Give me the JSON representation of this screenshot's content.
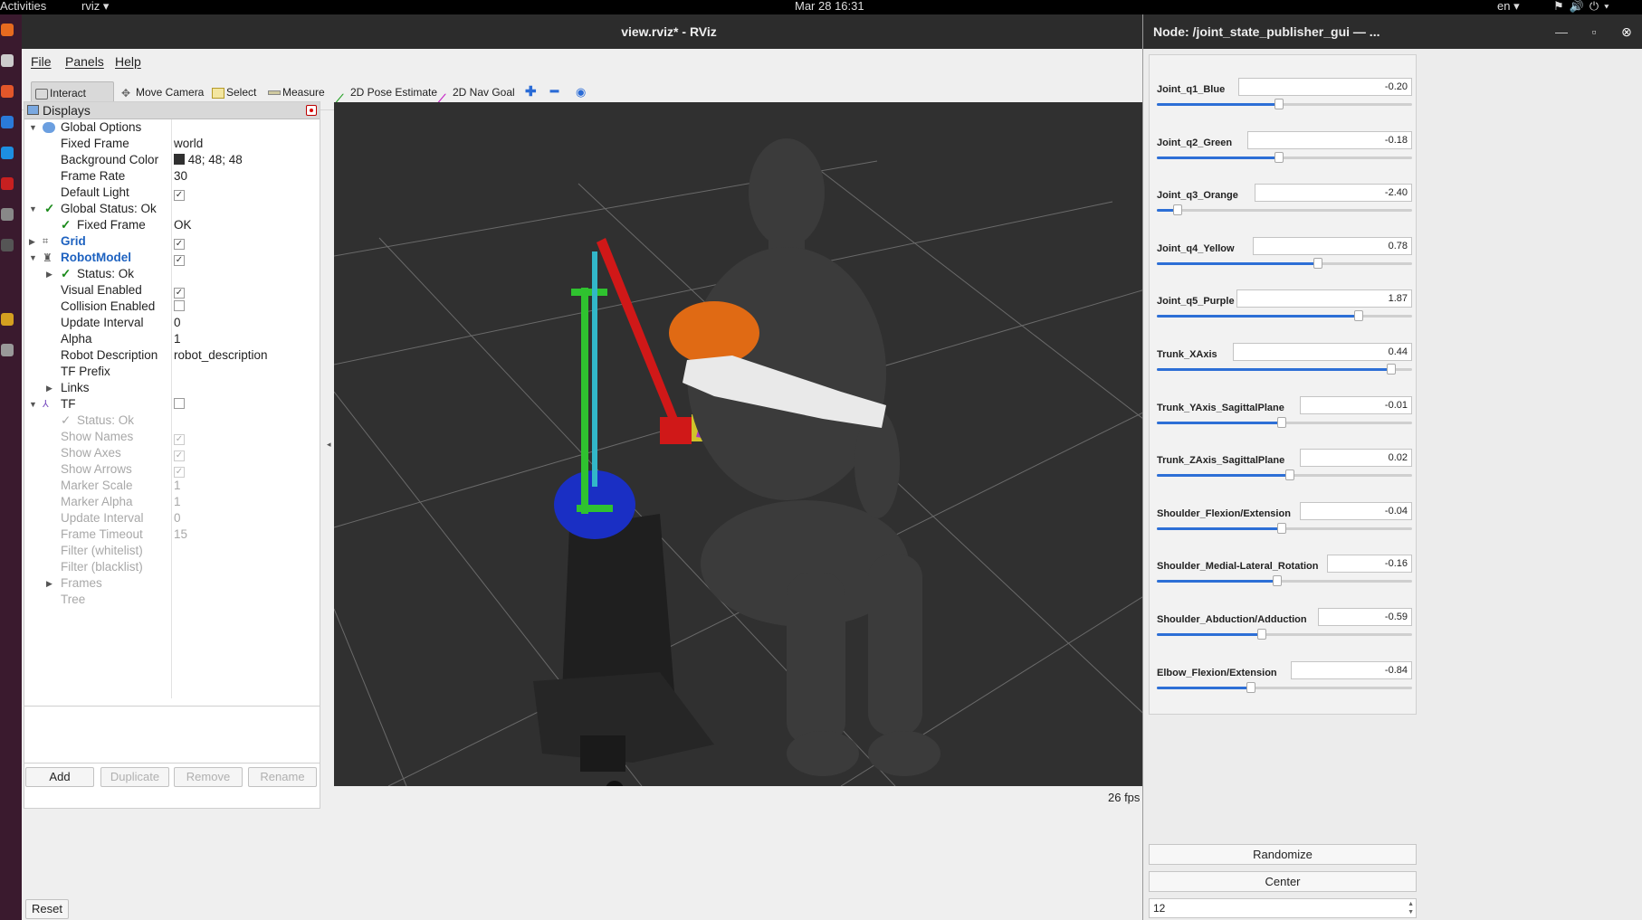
{
  "system_bar": {
    "activities": "Activities",
    "app": "rviz ▾",
    "clock": "Mar 28  16:31",
    "lang": "en ▾"
  },
  "rviz": {
    "title": "view.rviz* - RViz",
    "menu": [
      "File",
      "Panels",
      "Help"
    ],
    "toolbar": [
      "Interact",
      "Move Camera",
      "Select",
      "Measure",
      "2D Pose Estimate",
      "2D Nav Goal"
    ],
    "displays_title": "Displays",
    "tree": {
      "global_options": "Global Options",
      "fixed_frame_k": "Fixed Frame",
      "fixed_frame_v": "world",
      "bg_color_k": "Background Color",
      "bg_color_v": "48; 48; 48",
      "frame_rate_k": "Frame Rate",
      "frame_rate_v": "30",
      "default_light_k": "Default Light",
      "global_status": "Global Status: Ok",
      "gs_fixed_frame_k": "Fixed Frame",
      "gs_fixed_frame_v": "OK",
      "grid": "Grid",
      "robot_model": "RobotModel",
      "rm_status": "Status: Ok",
      "visual_enabled_k": "Visual Enabled",
      "collision_enabled_k": "Collision Enabled",
      "update_interval_k": "Update Interval",
      "update_interval_v": "0",
      "alpha_k": "Alpha",
      "alpha_v": "1",
      "robot_desc_k": "Robot Description",
      "robot_desc_v": "robot_description",
      "tf_prefix_k": "TF Prefix",
      "links": "Links",
      "tf": "TF",
      "tf_status": "Status: Ok",
      "show_names_k": "Show Names",
      "show_axes_k": "Show Axes",
      "show_arrows_k": "Show Arrows",
      "marker_scale_k": "Marker Scale",
      "marker_scale_v": "1",
      "marker_alpha_k": "Marker Alpha",
      "marker_alpha_v": "1",
      "tf_update_interval_k": "Update Interval",
      "tf_update_interval_v": "0",
      "frame_timeout_k": "Frame Timeout",
      "frame_timeout_v": "15",
      "filter_white_k": "Filter (whitelist)",
      "filter_black_k": "Filter (blacklist)",
      "frames": "Frames",
      "tree_item": "Tree"
    },
    "buttons": {
      "add": "Add",
      "duplicate": "Duplicate",
      "remove": "Remove",
      "rename": "Rename",
      "reset": "Reset"
    },
    "fps": "26 fps",
    "bg_swatch_color": "#303030"
  },
  "jsp": {
    "title": "Node: /joint_state_publisher_gui — ...",
    "joints": [
      {
        "name": "Joint_q1_Blue",
        "value": "-0.20",
        "level": 0.48
      },
      {
        "name": "Joint_q2_Green",
        "value": "-0.18",
        "level": 0.48
      },
      {
        "name": "Joint_q3_Orange",
        "value": "-2.40",
        "level": 0.08
      },
      {
        "name": "Joint_q4_Yellow",
        "value": "0.78",
        "level": 0.63
      },
      {
        "name": "Joint_q5_Purple",
        "value": "1.87",
        "level": 0.79
      },
      {
        "name": "Trunk_XAxis",
        "value": "0.44",
        "level": 0.92
      },
      {
        "name": "Trunk_YAxis_SagittalPlane",
        "value": "-0.01",
        "level": 0.49
      },
      {
        "name": "Trunk_ZAxis_SagittalPlane",
        "value": "0.02",
        "level": 0.52
      },
      {
        "name": "Shoulder_Flexion/Extension",
        "value": "-0.04",
        "level": 0.49
      },
      {
        "name": "Shoulder_Medial-Lateral_Rotation",
        "value": "-0.16",
        "level": 0.47
      },
      {
        "name": "Shoulder_Abduction/Adduction",
        "value": "-0.59",
        "level": 0.41
      },
      {
        "name": "Elbow_Flexion/Extension",
        "value": "-0.84",
        "level": 0.37
      }
    ],
    "randomize": "Randomize",
    "center": "Center",
    "spin_value": "12"
  }
}
